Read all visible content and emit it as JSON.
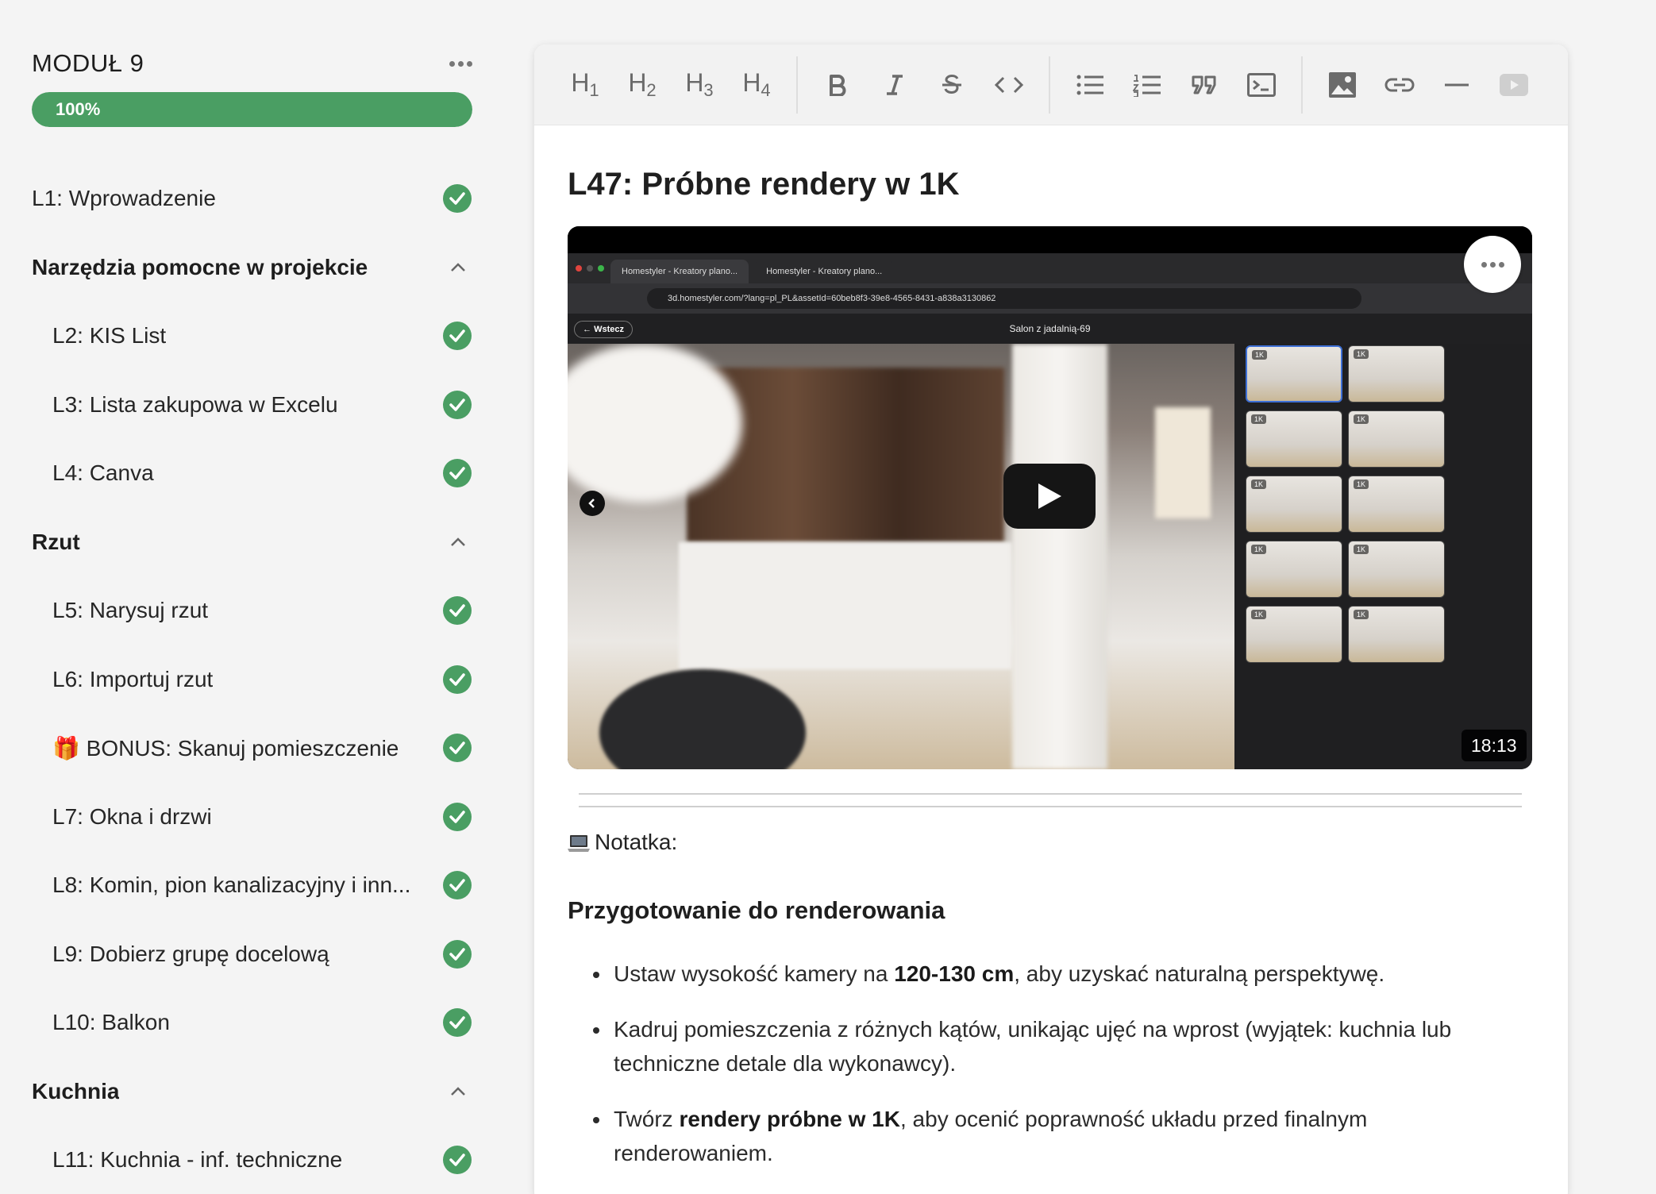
{
  "module": {
    "title": "MODUŁ 9",
    "progress_label": "100%",
    "progress_fraction": 1.0
  },
  "colors": {
    "accent_green": "#4a9e63",
    "selection_blue": "#3d6fd6"
  },
  "nav": [
    {
      "type": "lesson",
      "label": "L1: Wprowadzenie",
      "done": true
    },
    {
      "type": "section",
      "label": "Narzędzia pomocne w projekcie",
      "expanded": true
    },
    {
      "type": "sub",
      "label": "L2: KIS List",
      "done": true
    },
    {
      "type": "sub",
      "label": "L3: Lista zakupowa w Excelu",
      "done": true
    },
    {
      "type": "sub",
      "label": "L4: Canva",
      "done": true
    },
    {
      "type": "section",
      "label": "Rzut",
      "expanded": true
    },
    {
      "type": "sub",
      "label": "L5: Narysuj rzut",
      "done": true
    },
    {
      "type": "sub",
      "label": "L6: Importuj rzut",
      "done": true
    },
    {
      "type": "sub",
      "label": "🎁 BONUS: Skanuj pomieszczenie",
      "done": true
    },
    {
      "type": "sub",
      "label": "L7: Okna i drzwi",
      "done": true
    },
    {
      "type": "sub",
      "label": "L8: Komin, pion kanalizacyjny i inn...",
      "done": true
    },
    {
      "type": "sub",
      "label": "L9: Dobierz grupę docelową",
      "done": true
    },
    {
      "type": "sub",
      "label": "L10: Balkon",
      "done": true
    },
    {
      "type": "section",
      "label": "Kuchnia",
      "expanded": true
    },
    {
      "type": "sub",
      "label": "L11: Kuchnia - inf. techniczne",
      "done": true
    }
  ],
  "toolbar": {
    "headings": [
      {
        "label": "H",
        "level": "1"
      },
      {
        "label": "H",
        "level": "2"
      },
      {
        "label": "H",
        "level": "3"
      },
      {
        "label": "H",
        "level": "4"
      }
    ],
    "icons": [
      "bold-icon",
      "italic-icon",
      "strikethrough-icon",
      "code-icon",
      "bullet-list-icon",
      "numbered-list-icon",
      "quote-icon",
      "code-block-icon",
      "image-icon",
      "link-icon",
      "horizontal-rule-icon",
      "video-icon"
    ]
  },
  "lesson": {
    "title": "L47: Próbne rendery w 1K",
    "video": {
      "duration": "18:13",
      "tab1": "Homestyler - Kreatory plano...",
      "tab2": "Homestyler - Kreatory plano...",
      "url": "3d.homestyler.com/?lang=pl_PL&assetId=60beb8f3-39e8-4565-8431-a838a3130862",
      "back_label": "Wstecz",
      "scene_title": "Salon z jadalnią-69",
      "thumb_badge": "1K"
    },
    "note_label": "Notatka:",
    "section_heading": "Przygotowanie do renderowania",
    "bullets": [
      {
        "pre": "Ustaw wysokość kamery na ",
        "bold": "120-130 cm",
        "post": ", aby uzyskać naturalną perspektywę."
      },
      {
        "pre": "Kadruj pomieszczenia z różnych kątów, unikając ujęć na wprost (wyjątek: kuchnia lub techniczne detale dla wykonawcy).",
        "bold": "",
        "post": ""
      },
      {
        "pre": "Twórz ",
        "bold": "rendery próbne w 1K",
        "post": ", aby ocenić poprawność układu przed finalnym renderowaniem."
      }
    ]
  }
}
